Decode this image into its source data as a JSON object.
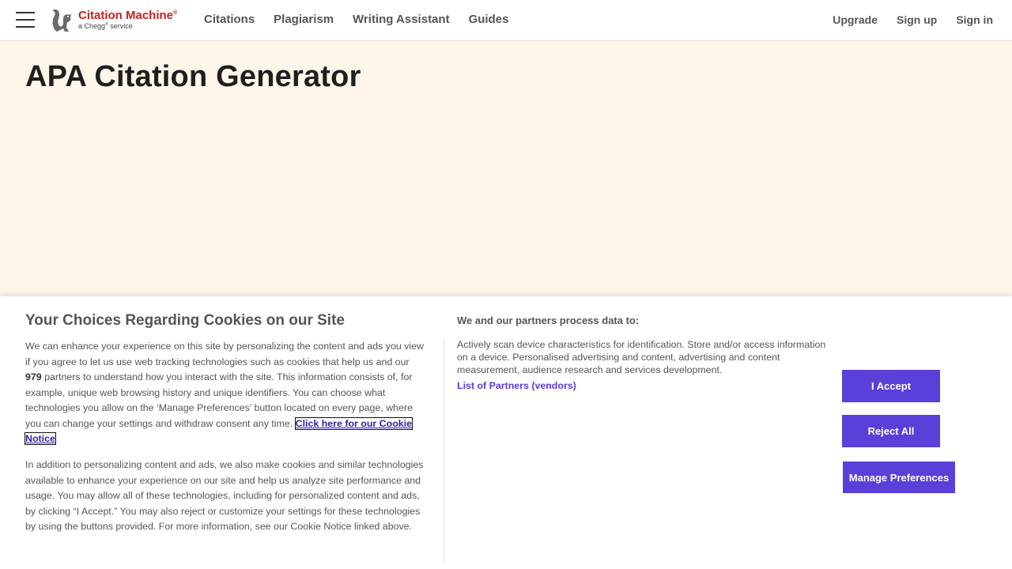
{
  "header": {
    "logo": {
      "title": "Citation Machine",
      "registered": "®",
      "subtitle_prefix": "a Chegg",
      "subtitle_mark": "®",
      "subtitle_suffix": " service"
    },
    "nav": [
      "Citations",
      "Plagiarism",
      "Writing Assistant",
      "Guides"
    ],
    "nav_right": [
      "Upgrade",
      "Sign up",
      "Sign in"
    ],
    "menu_icon": "hamburger-icon"
  },
  "main": {
    "title": "APA Citation Generator"
  },
  "cookie_banner": {
    "title": "Your Choices Regarding Cookies on our Site",
    "para1_a": "We can enhance your experience on this site by personalizing the content and ads you view if you agree to let us use web tracking technologies such as cookies that help us and our ",
    "partner_count": "979",
    "para1_b": " partners to understand how you interact with the site. This information consists of, for example, unique web browsing history and unique identifiers. You can choose what technologies you allow on the ‘Manage Preferences’ button located on every page, where you can change your settings and withdraw consent any time. ",
    "cookie_notice_link": "Click here for our Cookie Notice",
    "para2": "In addition to personalizing content and ads, we also make cookies and similar technologies available to enhance your experience on our site and help us analyze site performance and usage. You may allow all of these technologies, including for personalized content and ads, by clicking “I Accept.” You may also reject or customize your settings for these technologies by using the buttons provided. For more information, see our Cookie Notice linked above.",
    "partners_heading": "We and our partners process data to:",
    "partners_body": "Actively scan device characteristics for identification. Store and/or access information on a device. Personalised advertising and content, advertising and content measurement, audience research and services development.",
    "vendors_link": "List of Partners (vendors)",
    "accept_label": "I Accept",
    "reject_label": "Reject All",
    "manage_label": "Manage Preferences",
    "button_color": "#5b3fd9"
  }
}
